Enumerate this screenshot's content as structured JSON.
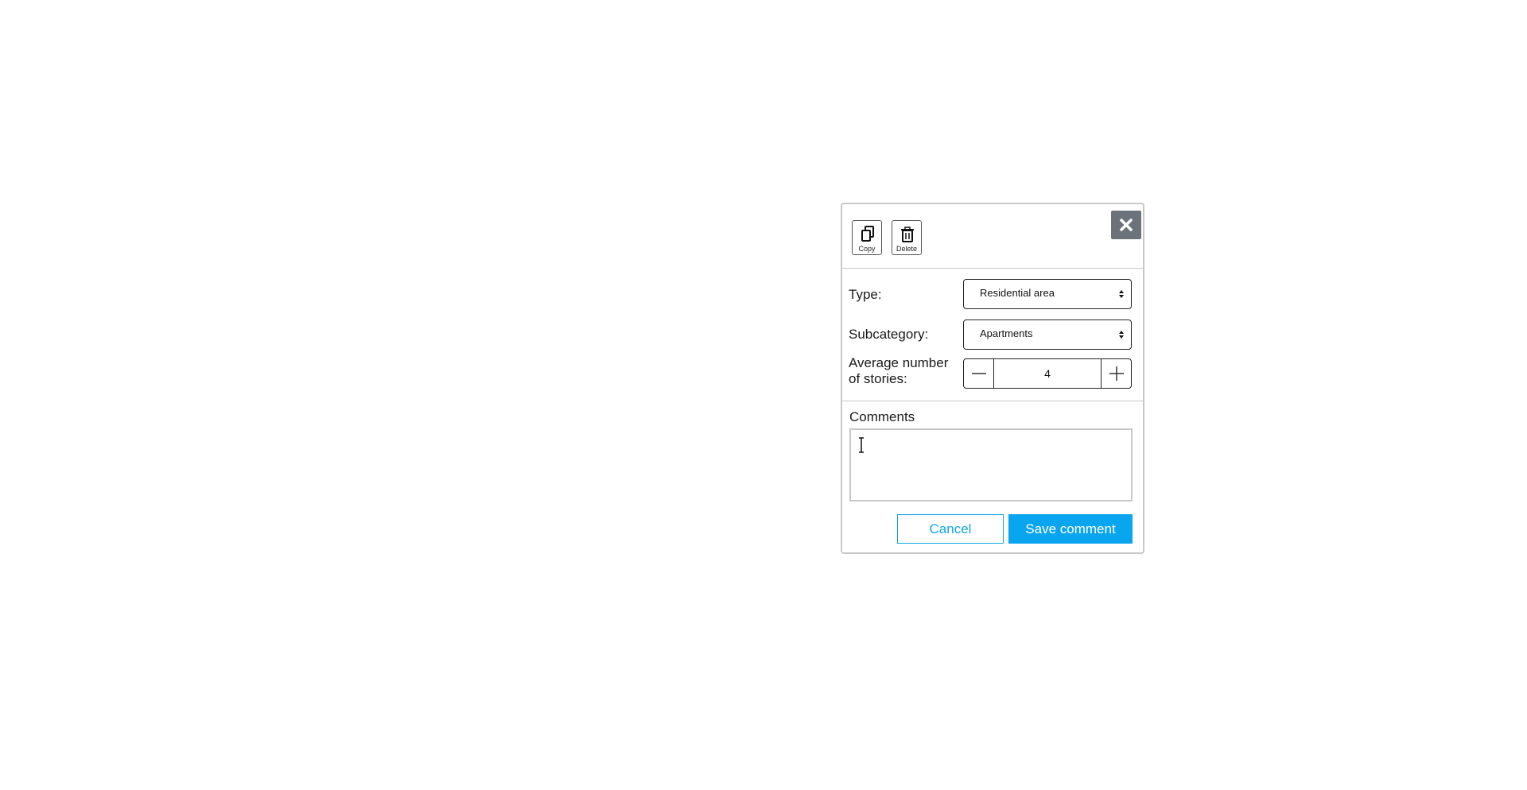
{
  "toolbar": {
    "copy_label": "Copy",
    "delete_label": "Delete",
    "close_icon": "close-icon"
  },
  "form": {
    "type_label": "Type:",
    "type_value": "Residential area",
    "subcategory_label": "Subcategory:",
    "subcategory_value": "Apartments",
    "stories_label_line1": "Average number",
    "stories_label_line2": "of stories:",
    "stories_value": "4"
  },
  "comments": {
    "label": "Comments",
    "value": ""
  },
  "actions": {
    "cancel_label": "Cancel",
    "save_label": "Save comment"
  },
  "colors": {
    "accent": "#0aa5ef",
    "close_bg": "#6b727a",
    "border": "#c8c8c8"
  }
}
